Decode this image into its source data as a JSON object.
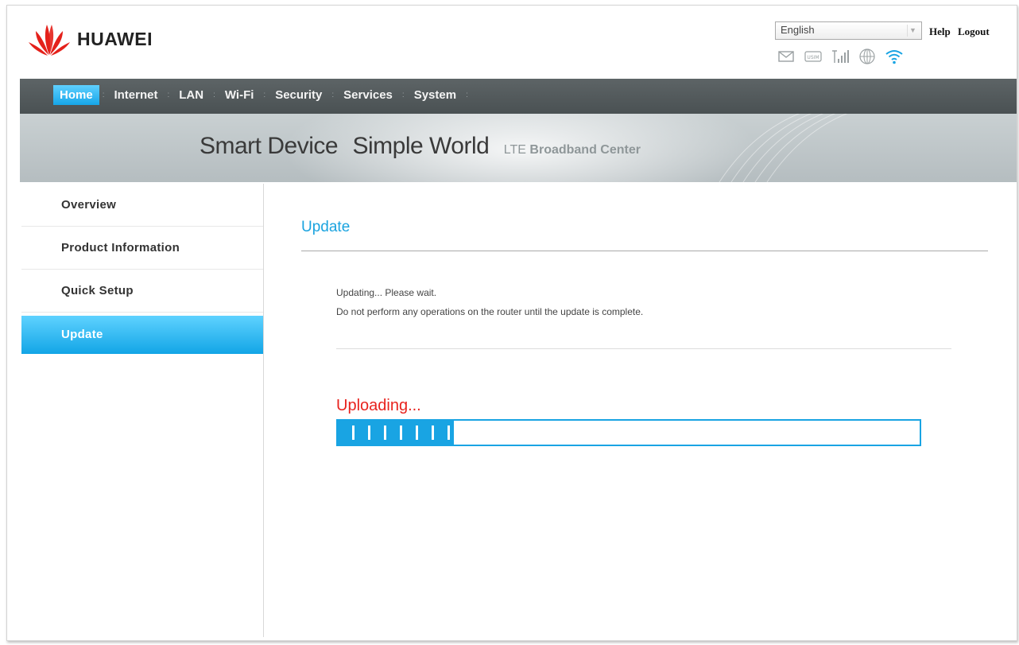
{
  "brand": {
    "name": "HUAWEI",
    "logo_color": "#e4211b"
  },
  "header": {
    "language": "English",
    "links": {
      "help": "Help",
      "logout": "Logout"
    },
    "status_icons": [
      "mail-icon",
      "sim-card-icon",
      "signal-strength-icon",
      "globe-icon",
      "wifi-icon"
    ],
    "sim_label": "USIM"
  },
  "nav": {
    "items": [
      "Home",
      "Internet",
      "LAN",
      "Wi-Fi",
      "Security",
      "Services",
      "System"
    ],
    "active": "Home",
    "separator": ":"
  },
  "banner": {
    "main1": "Smart Device",
    "main2": "Simple World",
    "sub_lte": "LTE",
    "sub_rest": "Broadband Center"
  },
  "sidebar": {
    "items": [
      "Overview",
      "Product Information",
      "Quick Setup",
      "Update"
    ],
    "active": "Update"
  },
  "main": {
    "title": "Update",
    "message_line1": "Updating... Please wait.",
    "message_line2": "Do not perform any operations on the router until the update is complete.",
    "progress_label": "Uploading...",
    "progress_fraction": 0.2,
    "progress_segments": 7
  },
  "colors": {
    "accent": "#19a4e3",
    "alert": "#e8231e",
    "nav_bg": "#4f5658"
  }
}
